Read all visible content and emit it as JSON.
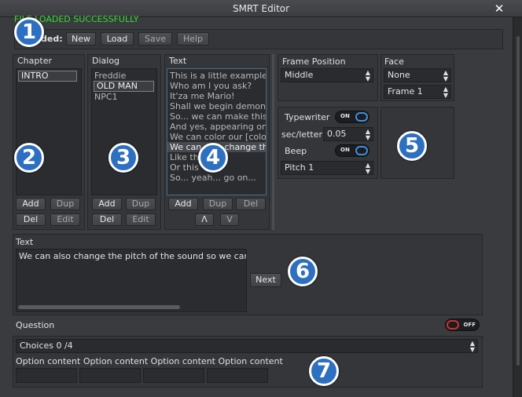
{
  "window": {
    "title": "SMRT Editor",
    "close_glyph": "✕"
  },
  "status": "FILE LOADED SUCCESSFULLY",
  "file": {
    "label": "ded:",
    "new": "New",
    "load": "Load",
    "save": "Save",
    "help": "Help"
  },
  "chapter": {
    "header": "Chapter",
    "items": [
      "INTRO"
    ],
    "add": "Add",
    "dup": "Dup",
    "del": "Del",
    "edit": "Edit"
  },
  "dialog": {
    "header": "Dialog",
    "items": [
      "Freddie",
      "OLD MAN",
      "NPC1"
    ],
    "add": "Add",
    "dup": "Dup",
    "del": "Del",
    "edit": "Edit"
  },
  "text_list": {
    "header": "Text",
    "items": [
      "This is a little example",
      "Who am I you ask?",
      "It'za me Mario!",
      "Shall we begin demonst",
      "So... we can make this g",
      "And yes, appearing on t",
      "We can color our [colors",
      "We can also change the",
      "Like th",
      "Or this",
      "So... yeah... go on..."
    ],
    "add": "Add",
    "dup": "Dup",
    "del": "Del",
    "up": "Λ",
    "down": "V"
  },
  "frame": {
    "header": "Frame Position",
    "value": "Middle"
  },
  "face": {
    "header": "Face",
    "value": "None",
    "frame_value": "Frame 1"
  },
  "typewriter": {
    "label": "Typewriter",
    "toggle": "ON",
    "sec_label": "sec/letter",
    "sec_value": "0.05",
    "beep_label": "Beep",
    "beep_toggle": "ON",
    "pitch_value": "Pitch 1"
  },
  "text_edit": {
    "header": "Text",
    "value": "We can also change the pitch of the sound so we can giv",
    "next": "Next"
  },
  "question": {
    "label": "Question",
    "toggle": "OFF"
  },
  "choices": {
    "value": "Choices 0 /4",
    "options": [
      "Option content",
      "Option content",
      "Option content",
      "Option content"
    ]
  },
  "badges": [
    "1",
    "2",
    "3",
    "4",
    "5",
    "6",
    "7"
  ],
  "colors": {
    "status_green": "#33dd33",
    "badge_blue": "#2d6fc0",
    "toggle_on": "#3d8fe0",
    "toggle_off": "#d03030"
  }
}
